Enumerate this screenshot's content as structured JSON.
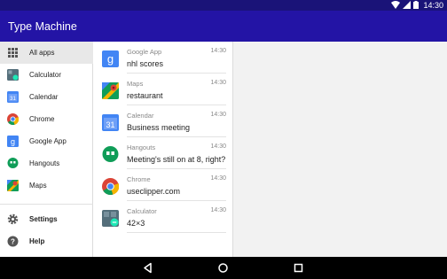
{
  "status_bar": {
    "time": "14:30",
    "icons": [
      "wifi-icon",
      "signal-icon",
      "battery-icon"
    ]
  },
  "app_bar": {
    "title": "Type Machine"
  },
  "drawer": {
    "items": [
      {
        "label": "All apps",
        "icon": "grid-icon",
        "active": true
      },
      {
        "label": "Calculator",
        "icon": "calculator-icon"
      },
      {
        "label": "Calendar",
        "icon": "calendar-icon"
      },
      {
        "label": "Chrome",
        "icon": "chrome-icon"
      },
      {
        "label": "Google App",
        "icon": "google-app-icon"
      },
      {
        "label": "Hangouts",
        "icon": "hangouts-icon"
      },
      {
        "label": "Maps",
        "icon": "maps-icon"
      }
    ],
    "footer": [
      {
        "label": "Settings",
        "icon": "gear-icon"
      },
      {
        "label": "Help",
        "icon": "help-icon"
      }
    ]
  },
  "notifications": [
    {
      "app": "Google App",
      "time": "14:30",
      "text": "nhl scores",
      "icon": "google-app-icon"
    },
    {
      "app": "Maps",
      "time": "14:30",
      "text": "restaurant",
      "icon": "maps-icon"
    },
    {
      "app": "Calendar",
      "time": "14:30",
      "text": "Business meeting",
      "icon": "calendar-icon"
    },
    {
      "app": "Hangouts",
      "time": "14:30",
      "text": "Meeting's still on at 8, right?",
      "icon": "hangouts-icon"
    },
    {
      "app": "Chrome",
      "time": "14:30",
      "text": "useclipper.com",
      "icon": "chrome-icon"
    },
    {
      "app": "Calculator",
      "time": "14:30",
      "text": "42×3",
      "icon": "calculator-icon"
    }
  ],
  "nav_bar": {
    "buttons": [
      "back-icon",
      "home-icon",
      "recents-icon"
    ]
  },
  "colors": {
    "status_bar": "#1a1378",
    "app_bar": "#2314a5",
    "drawer_active": "#e8e8e8"
  }
}
